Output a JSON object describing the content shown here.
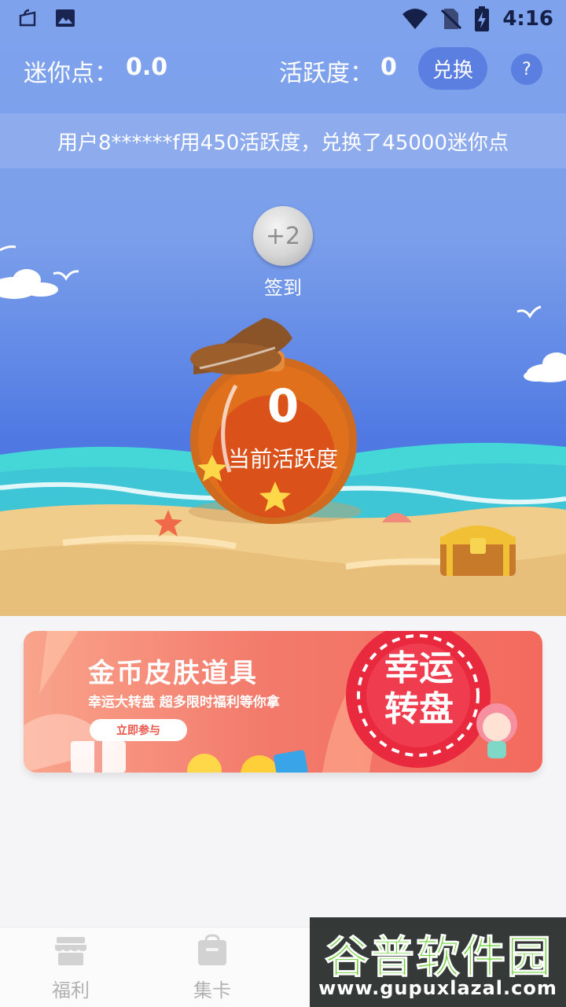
{
  "status_bar": {
    "time": "4:16",
    "left_icons": [
      "notification-bag-icon",
      "image-icon"
    ],
    "right_icons": [
      "wifi-icon",
      "no-sim-icon",
      "battery-charging-icon"
    ]
  },
  "header": {
    "mini_points_label": "迷你点：",
    "mini_points_value": "0.0",
    "activity_label": "活跃度：",
    "activity_value": "0",
    "exchange_button": "兑换",
    "help_button": "?"
  },
  "ticker": {
    "text": "用户8******f用450活跃度，兑换了45000迷你点"
  },
  "checkin": {
    "reward": "+2",
    "label": "签到"
  },
  "bottle": {
    "value": "0",
    "label": "当前活跃度"
  },
  "banner": {
    "title": "金币皮肤道具",
    "subtitle": "幸运大转盘  超多限时福利等你拿",
    "button": "立即参与",
    "wheel_line1": "幸运",
    "wheel_line2": "转盘"
  },
  "bottom_nav": {
    "items": [
      {
        "label": "福利",
        "icon": "store-icon"
      },
      {
        "label": "集卡",
        "icon": "card-bag-icon"
      }
    ]
  },
  "watermark": {
    "title": "谷普软件园",
    "url": "www.gupuxlazal.com"
  },
  "colors": {
    "sky_top": "#7ea2ec",
    "sky_bottom": "#4f78e2",
    "ticker_bg": "#8eaced",
    "button_bg": "#5b7fe0",
    "sea": "#45d7d7",
    "sand": "#f0cd8b",
    "banner_start": "#f9a48c",
    "banner_end": "#f36a5d",
    "wheel_red": "#e8293e",
    "watermark_green": "#6fd23a"
  }
}
